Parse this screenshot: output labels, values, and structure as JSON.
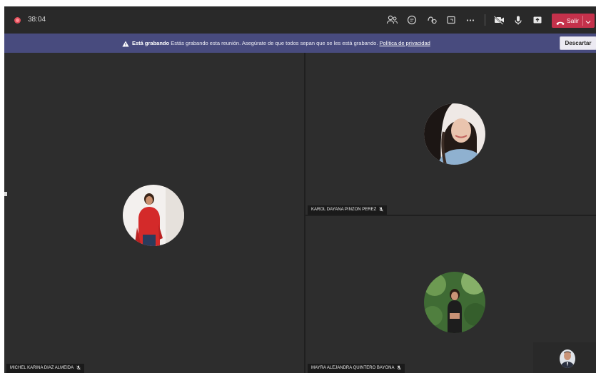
{
  "meeting": {
    "timer": "38:04"
  },
  "toolbar": {
    "icons": [
      "participants-icon",
      "chat-icon",
      "reactions-icon",
      "share-tray-icon",
      "more-options-icon",
      "camera-off-icon",
      "microphone-icon",
      "share-icon"
    ],
    "leave_label": "Salir"
  },
  "banner": {
    "title": "Está grabando",
    "message": "Estás grabando esta reunión. Asegúrate de que todos sepan que se les está grabando.",
    "link": "Política de privacidad",
    "dismiss_label": "Descartar"
  },
  "participants": [
    {
      "name": "MICHEL KARINA DIAZ ALMEIDA"
    },
    {
      "name": "KAROL DAYANA PINZON PEREZ"
    },
    {
      "name": "MAYRA ALEJANDRA QUINTERO BAYONA"
    }
  ],
  "colors": {
    "top_bar": "#292929",
    "banner": "#484b7e",
    "leave_button": "#c4314b",
    "recording": "#e04e5a"
  }
}
